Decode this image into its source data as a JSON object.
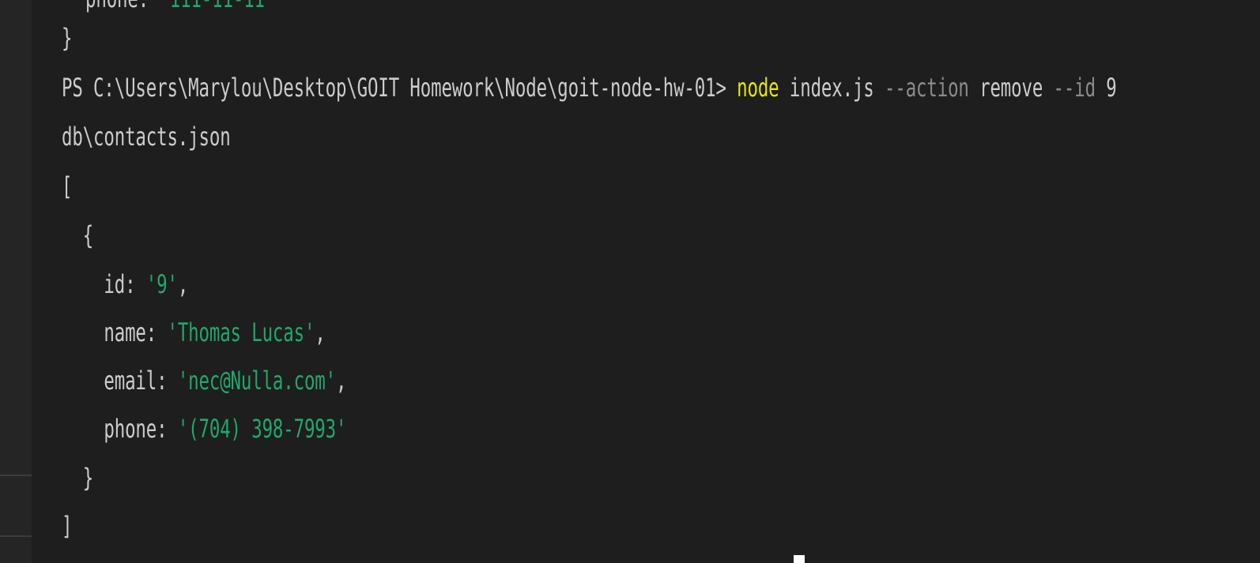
{
  "terminal": {
    "line0": {
      "key": "phone: ",
      "value": "'111-11-11'"
    },
    "line1": {
      "text": "}"
    },
    "prompt": {
      "path": "PS C:\\Users\\Marylou\\Desktop\\GOIT Homework\\Node\\goit-node-hw-01> ",
      "command": "node",
      "arg_file": " index.js ",
      "flag_action": "--action",
      "arg_action": " remove ",
      "flag_id": "--id",
      "arg_id": " 9"
    },
    "output_file": "db\\contacts.json",
    "open_bracket": "[",
    "open_brace": "  {",
    "id_key": "    id: ",
    "id_value": "'9'",
    "id_comma": ",",
    "name_key": "    name: ",
    "name_value": "'Thomas Lucas'",
    "name_comma": ",",
    "email_key": "    email: ",
    "email_value": "'nec@Nulla.com'",
    "email_comma": ",",
    "phone_key": "    phone: ",
    "phone_value": "'(704) 398-7993'",
    "close_brace": "  }",
    "close_bracket": "]"
  },
  "colors": {
    "background": "#1e1e1e",
    "text": "#cccccc",
    "string": "#21a86b",
    "command": "#e5e510",
    "flag": "#8b8b8b"
  }
}
